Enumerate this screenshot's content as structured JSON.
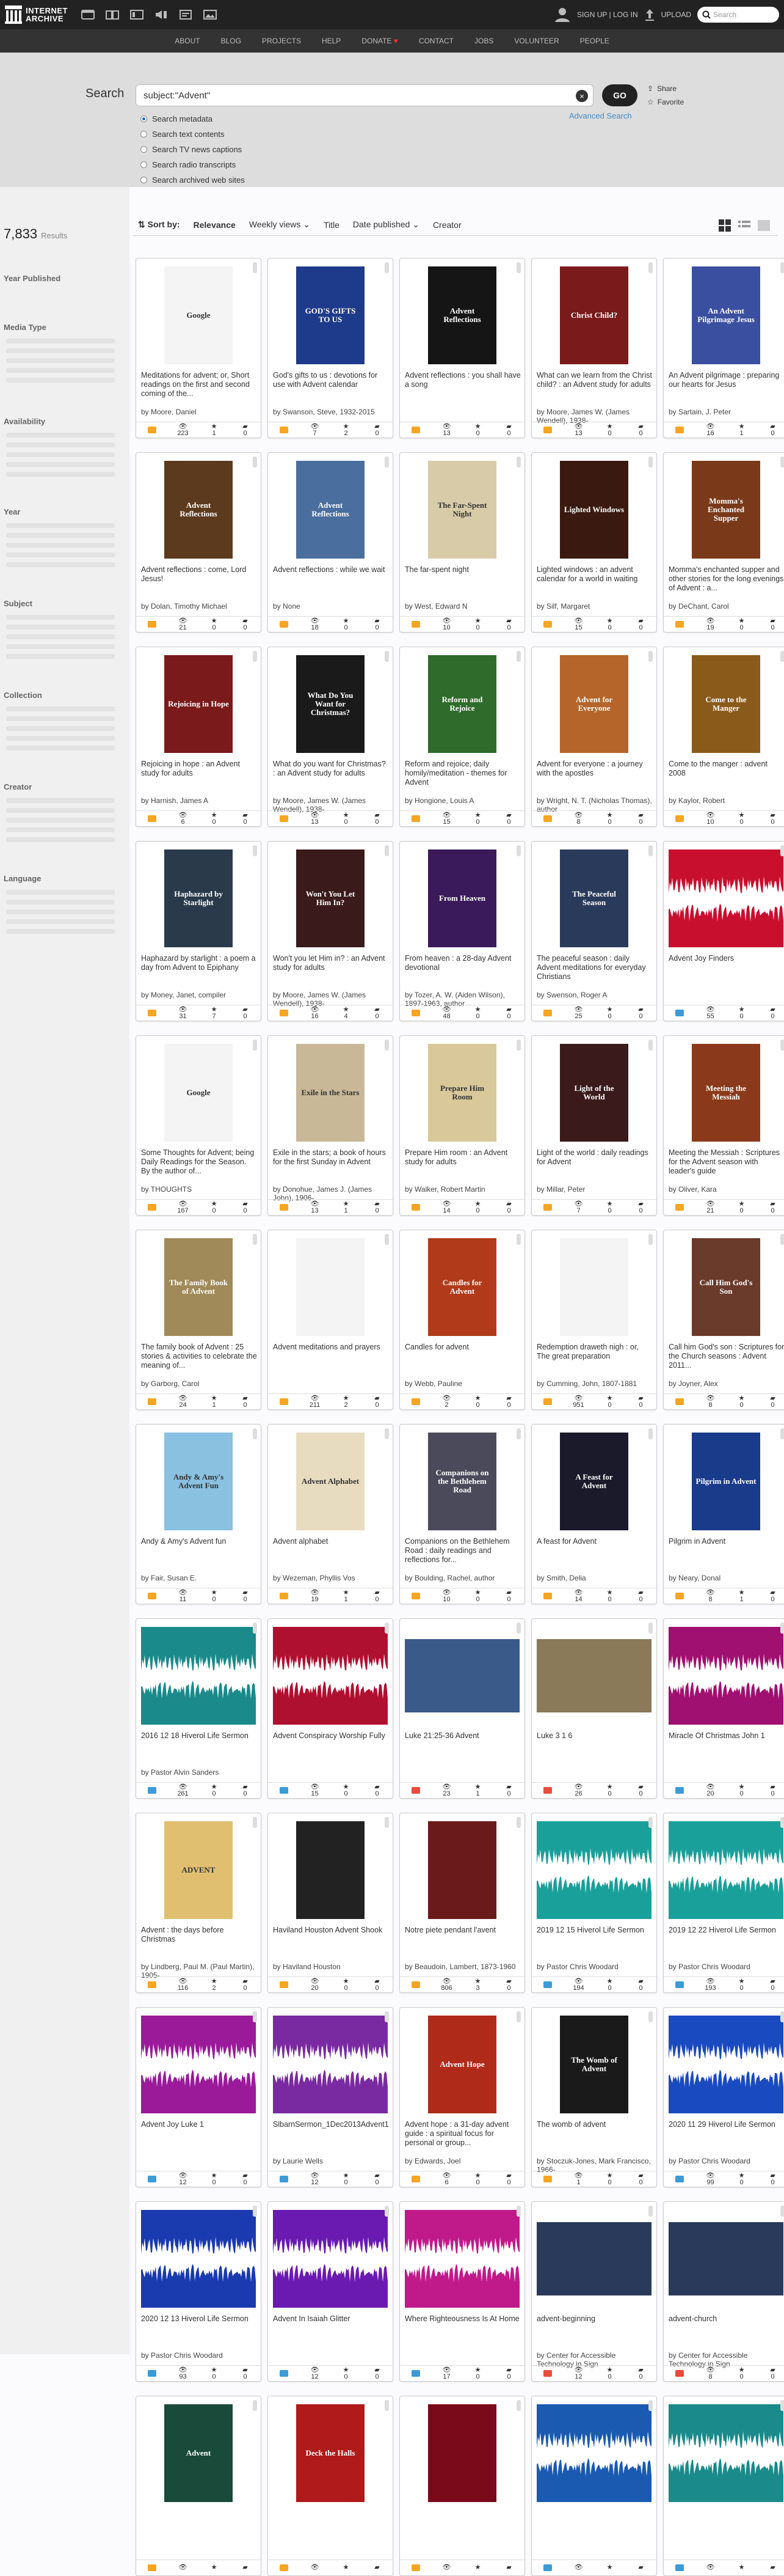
{
  "header": {
    "logo_line1": "INTERNET",
    "logo_line2": "ARCHIVE",
    "signup": "SIGN UP | LOG IN",
    "upload": "UPLOAD",
    "search_placeholder": "Search"
  },
  "subnav": [
    "ABOUT",
    "BLOG",
    "PROJECTS",
    "HELP",
    "DONATE",
    "CONTACT",
    "JOBS",
    "VOLUNTEER",
    "PEOPLE"
  ],
  "search": {
    "label": "Search",
    "query": "subject:\"Advent\"",
    "go": "GO",
    "share": "Share",
    "favorite": "Favorite",
    "advanced": "Advanced Search",
    "options": [
      "Search metadata",
      "Search text contents",
      "Search TV news captions",
      "Search radio transcripts",
      "Search archived web sites"
    ]
  },
  "sidebar": {
    "count": "7,833",
    "count_label": "Results",
    "facets": [
      "Year Published",
      "Media Type",
      "Availability",
      "Year",
      "Subject",
      "Collection",
      "Creator",
      "Language"
    ]
  },
  "sort": {
    "label": "Sort by:",
    "options": [
      "Relevance",
      "Weekly views",
      "Title",
      "Date published",
      "Creator"
    ]
  },
  "colors": {
    "text_type": "#f5a623",
    "audio_type": "#3d9bd6",
    "video_type": "#e84c3d"
  },
  "items": [
    {
      "title": "Meditations for advent; or, Short readings on the first and second coming of the...",
      "author": "by Moore, Daniel",
      "type": "text",
      "views": "223",
      "favs": "1",
      "reviews": "0",
      "thumb": "#f4f4f4",
      "label": "Google"
    },
    {
      "title": "God's gifts to us : devotions for use with Advent calendar",
      "author": "by Swanson, Steve, 1932-2015",
      "type": "text",
      "views": "7",
      "favs": "2",
      "reviews": "0",
      "thumb": "#1e3a8a",
      "label": "GOD'S GIFTS TO US"
    },
    {
      "title": "Advent reflections : you shall have a song",
      "author": "",
      "type": "text",
      "views": "13",
      "favs": "0",
      "reviews": "0",
      "thumb": "#151515",
      "label": "Advent Reflections"
    },
    {
      "title": "What can we learn from the Christ child? : an Advent study for adults",
      "author": "by Moore, James W. (James Wendell), 1938-",
      "type": "text",
      "views": "13",
      "favs": "0",
      "reviews": "0",
      "thumb": "#7a1a1a",
      "label": "Christ Child?"
    },
    {
      "title": "An Advent pilgrimage : preparing our hearts for Jesus",
      "author": "by Sartain, J. Peter",
      "type": "text",
      "views": "16",
      "favs": "1",
      "reviews": "0",
      "thumb": "#3a4fa0",
      "label": "An Advent Pilgrimage Jesus"
    },
    {
      "title": "Advent reflections : come, Lord Jesus!",
      "author": "by Dolan, Timothy Michael",
      "type": "text",
      "views": "21",
      "favs": "0",
      "reviews": "0",
      "thumb": "#5c3a1e",
      "label": "Advent Reflections"
    },
    {
      "title": "Advent reflections : while we wait",
      "author": "by None",
      "type": "text",
      "views": "18",
      "favs": "0",
      "reviews": "0",
      "thumb": "#4a6e9e",
      "label": "Advent Reflections"
    },
    {
      "title": "The far-spent night",
      "author": "by West, Edward N",
      "type": "text",
      "views": "10",
      "favs": "0",
      "reviews": "0",
      "thumb": "#d8cba8",
      "label": "The Far-Spent Night"
    },
    {
      "title": "Lighted windows : an advent calendar for a world in waiting",
      "author": "by Silf, Margaret",
      "type": "text",
      "views": "15",
      "favs": "0",
      "reviews": "0",
      "thumb": "#3a1a10",
      "label": "Lighted Windows"
    },
    {
      "title": "Momma's enchanted supper and other stories for the long evenings of Advent : a...",
      "author": "by DeChant, Carol",
      "type": "text",
      "views": "19",
      "favs": "0",
      "reviews": "0",
      "thumb": "#7a3a1a",
      "label": "Momma's Enchanted Supper"
    },
    {
      "title": "Rejoicing in hope : an Advent study for adults",
      "author": "by Harnish, James A",
      "type": "text",
      "views": "6",
      "favs": "0",
      "reviews": "0",
      "thumb": "#7a1a1a",
      "label": "Rejoicing in Hope"
    },
    {
      "title": "What do you want for Christmas? : an Advent study for adults",
      "author": "by Moore, James W. (James Wendell), 1938-",
      "type": "text",
      "views": "13",
      "favs": "0",
      "reviews": "0",
      "thumb": "#1a1a1a",
      "label": "What Do You Want for Christmas?"
    },
    {
      "title": "Reform and rejoice; daily homily/meditation - themes for Advent",
      "author": "by Hongione, Louis A",
      "type": "text",
      "views": "15",
      "favs": "0",
      "reviews": "0",
      "thumb": "#2f6b2a",
      "label": "Reform and Rejoice"
    },
    {
      "title": "Advent for everyone : a journey with the apostles",
      "author": "by Wright, N. T. (Nicholas Thomas), author",
      "type": "text",
      "views": "8",
      "favs": "0",
      "reviews": "0",
      "thumb": "#b5652a",
      "label": "Advent for Everyone"
    },
    {
      "title": "Come to the manger : advent 2008",
      "author": "by Kaylor, Robert",
      "type": "text",
      "views": "10",
      "favs": "0",
      "reviews": "0",
      "thumb": "#8a5a1a",
      "label": "Come to the Manger"
    },
    {
      "title": "Haphazard by starlight : a poem a day from Advent to Epiphany",
      "author": "by Money, Janet, compiler",
      "type": "text",
      "views": "31",
      "favs": "7",
      "reviews": "0",
      "thumb": "#2a3a4a",
      "label": "Haphazard by Starlight"
    },
    {
      "title": "Won't you let Him in? : an Advent study for adults",
      "author": "by Moore, James W. (James Wendell), 1938-",
      "type": "text",
      "views": "16",
      "favs": "4",
      "reviews": "0",
      "thumb": "#3a1a1a",
      "label": "Won't You Let Him In?"
    },
    {
      "title": "From heaven : a 28-day Advent devotional",
      "author": "by Tozer, A. W. (Aiden Wilson), 1897-1963, author",
      "type": "text",
      "views": "48",
      "favs": "0",
      "reviews": "0",
      "thumb": "#3a1a5a",
      "label": "From Heaven"
    },
    {
      "title": "The peaceful season : daily Advent meditations for everyday Christians",
      "author": "by Swenson, Roger A",
      "type": "text",
      "views": "25",
      "favs": "0",
      "reviews": "0",
      "thumb": "#2a3a5a",
      "label": "The Peaceful Season"
    },
    {
      "title": "Advent Joy Finders",
      "author": "",
      "type": "audio",
      "views": "55",
      "favs": "0",
      "reviews": "0",
      "thumb": "#c8102e",
      "label": ""
    },
    {
      "title": "Some Thoughts for Advent; being Daily Readings for the Season. By the author of...",
      "author": "by THOUGHTS",
      "type": "text",
      "views": "167",
      "favs": "0",
      "reviews": "0",
      "thumb": "#f4f4f4",
      "label": "Google"
    },
    {
      "title": "Exile in the stars; a book of hours for the first Sunday in Advent",
      "author": "by Donohue, James J. (James John), 1906-",
      "type": "text",
      "views": "13",
      "favs": "1",
      "reviews": "0",
      "thumb": "#c8b898",
      "label": "Exile in the Stars"
    },
    {
      "title": "Prepare Him room : an Advent study for adults",
      "author": "by Walker, Robert Martin",
      "type": "text",
      "views": "14",
      "favs": "0",
      "reviews": "0",
      "thumb": "#d8c89a",
      "label": "Prepare Him Room"
    },
    {
      "title": "Light of the world : daily readings for Advent",
      "author": "by Millar, Peter",
      "type": "text",
      "views": "7",
      "favs": "0",
      "reviews": "0",
      "thumb": "#3a1a1a",
      "label": "Light of the World"
    },
    {
      "title": "Meeting the Messiah : Scriptures for the Advent season with leader's guide",
      "author": "by Oliver, Kara",
      "type": "text",
      "views": "21",
      "favs": "0",
      "reviews": "0",
      "thumb": "#8a3a1a",
      "label": "Meeting the Messiah"
    },
    {
      "title": "The family book of Advent : 25 stories & activities to celebrate the meaning of...",
      "author": "by Garborg, Carol",
      "type": "text",
      "views": "24",
      "favs": "1",
      "reviews": "0",
      "thumb": "#a08a5a",
      "label": "The Family Book of Advent"
    },
    {
      "title": "Advent meditations and prayers",
      "author": "",
      "type": "text",
      "views": "211",
      "favs": "2",
      "reviews": "0",
      "thumb": "#f4f4f4",
      "label": ""
    },
    {
      "title": "Candles for advent",
      "author": "by Webb, Pauline",
      "type": "text",
      "views": "2",
      "favs": "0",
      "reviews": "0",
      "thumb": "#b03a1a",
      "label": "Candles for Advent"
    },
    {
      "title": "Redemption draweth nigh : or, The great preparation",
      "author": "by Cumming, John, 1807-1881",
      "type": "text",
      "views": "951",
      "favs": "0",
      "reviews": "0",
      "thumb": "#f4f4f4",
      "label": ""
    },
    {
      "title": "Call him God's son : Scriptures for the Church seasons : Advent 2011...",
      "author": "by Joyner, Alex",
      "type": "text",
      "views": "8",
      "favs": "0",
      "reviews": "0",
      "thumb": "#6a3a2a",
      "label": "Call Him God's Son"
    },
    {
      "title": "Andy & Amy's Advent fun",
      "author": "by Fair, Susan E.",
      "type": "text",
      "views": "11",
      "favs": "0",
      "reviews": "0",
      "thumb": "#8ac0e0",
      "label": "Andy & Amy's Advent Fun"
    },
    {
      "title": "Advent alphabet",
      "author": "by Wezeman, Phyllis Vos",
      "type": "text",
      "views": "19",
      "favs": "1",
      "reviews": "0",
      "thumb": "#e8dcc0",
      "label": "Advent Alphabet"
    },
    {
      "title": "Companions on the Bethlehem Road : daily readings and reflections for...",
      "author": "by Boulding, Rachel, author",
      "type": "text",
      "views": "10",
      "favs": "0",
      "reviews": "0",
      "thumb": "#4a4a5a",
      "label": "Companions on the Bethlehem Road"
    },
    {
      "title": "A feast for Advent",
      "author": "by Smith, Delia",
      "type": "text",
      "views": "14",
      "favs": "0",
      "reviews": "0",
      "thumb": "#1a1a2a",
      "label": "A Feast for Advent"
    },
    {
      "title": "Pilgrim in Advent",
      "author": "by Neary, Donal",
      "type": "text",
      "views": "8",
      "favs": "1",
      "reviews": "0",
      "thumb": "#1a3a8a",
      "label": "Pilgrim in Advent"
    },
    {
      "title": "2016 12 18 Hiverol Life Sermon",
      "author": "by Pastor Alvin Sanders",
      "type": "audio",
      "views": "261",
      "favs": "0",
      "reviews": "0",
      "thumb": "#1a8a8a",
      "label": ""
    },
    {
      "title": "Advent Conspiracy Worship Fully",
      "author": "",
      "type": "audio",
      "views": "15",
      "favs": "0",
      "reviews": "0",
      "thumb": "#b01030",
      "label": ""
    },
    {
      "title": "Luke 21:25-36 Advent",
      "author": "",
      "type": "video",
      "views": "23",
      "favs": "1",
      "reviews": "0",
      "thumb": "#3a5a8a",
      "label": ""
    },
    {
      "title": "Luke 3 1 6",
      "author": "",
      "type": "video",
      "views": "26",
      "favs": "0",
      "reviews": "0",
      "thumb": "#8a7a5a",
      "label": ""
    },
    {
      "title": "Miracle Of Christmas John 1",
      "author": "",
      "type": "audio",
      "views": "20",
      "favs": "0",
      "reviews": "0",
      "thumb": "#a01070",
      "label": ""
    },
    {
      "title": "Advent : the days before Christmas",
      "author": "by Lindberg, Paul M. (Paul Martin), 1905-",
      "type": "text",
      "views": "116",
      "favs": "2",
      "reviews": "0",
      "thumb": "#e0c070",
      "label": "ADVENT"
    },
    {
      "title": "Haviland Houston Advent Shook",
      "author": "by Haviland Houston",
      "type": "text",
      "views": "20",
      "favs": "0",
      "reviews": "0",
      "thumb": "#222222",
      "label": ""
    },
    {
      "title": "Notre piete pendant l'avent",
      "author": "by Beaudoin, Lambert, 1873-1960",
      "type": "text",
      "views": "806",
      "favs": "3",
      "reviews": "0",
      "thumb": "#6a1a1a",
      "label": ""
    },
    {
      "title": "2019 12 15 Hiverol Life Sermon",
      "author": "by Pastor Chris Woodard",
      "type": "audio",
      "views": "194",
      "favs": "0",
      "reviews": "0",
      "thumb": "#1aa09a",
      "label": ""
    },
    {
      "title": "2019 12 22 Hiverol Life Sermon",
      "author": "by Pastor Chris Woodard",
      "type": "audio",
      "views": "193",
      "favs": "0",
      "reviews": "0",
      "thumb": "#1aa09a",
      "label": ""
    },
    {
      "title": "Advent Joy Luke 1",
      "author": "",
      "type": "audio",
      "views": "12",
      "favs": "0",
      "reviews": "0",
      "thumb": "#9a1a9a",
      "label": ""
    },
    {
      "title": "SlbarnSermon_1Dec2013Advent1CRevLaurieWells",
      "author": "by Laurie Wells",
      "type": "audio",
      "views": "12",
      "favs": "0",
      "reviews": "0",
      "thumb": "#7a2aa0",
      "label": ""
    },
    {
      "title": "Advent hope : a 31-day advent guide : a spiritual focus for personal or group...",
      "author": "by Edwards, Joel",
      "type": "text",
      "views": "6",
      "favs": "0",
      "reviews": "0",
      "thumb": "#b02a1a",
      "label": "Advent Hope"
    },
    {
      "title": "The womb of advent",
      "author": "by Stoczuk-Jones, Mark Francisco, 1966-",
      "type": "text",
      "views": "1",
      "favs": "0",
      "reviews": "0",
      "thumb": "#1a1a1a",
      "label": "The Womb of Advent"
    },
    {
      "title": "2020 11 29 Hiverol Life Sermon",
      "author": "by Pastor Chris Woodard",
      "type": "audio",
      "views": "99",
      "favs": "0",
      "reviews": "0",
      "thumb": "#1a4ac0",
      "label": ""
    },
    {
      "title": "2020 12 13 Hiverol Life Sermon",
      "author": "by Pastor Chris Woodard",
      "type": "audio",
      "views": "93",
      "favs": "0",
      "reviews": "0",
      "thumb": "#1a3ab0",
      "label": ""
    },
    {
      "title": "Advent In Isaiah Glitter",
      "author": "",
      "type": "audio",
      "views": "12",
      "favs": "0",
      "reviews": "0",
      "thumb": "#6a1ab0",
      "label": ""
    },
    {
      "title": "Where Righteousness Is At Home",
      "author": "",
      "type": "audio",
      "views": "17",
      "favs": "0",
      "reviews": "0",
      "thumb": "#c01a8a",
      "label": ""
    },
    {
      "title": "advent-beginning",
      "author": "by Center for Accessible Technology in Sign",
      "type": "video",
      "views": "12",
      "favs": "0",
      "reviews": "0",
      "thumb": "#2a3a5a",
      "label": ""
    },
    {
      "title": "advent-church",
      "author": "by Center for Accessible Technology in Sign",
      "type": "video",
      "views": "8",
      "favs": "0",
      "reviews": "0",
      "thumb": "#2a3a5a",
      "label": ""
    },
    {
      "title": "",
      "author": "",
      "type": "text",
      "views": "",
      "favs": "",
      "reviews": "",
      "thumb": "#1a4a3a",
      "label": "Advent"
    },
    {
      "title": "",
      "author": "",
      "type": "text",
      "views": "",
      "favs": "",
      "reviews": "",
      "thumb": "#b01a1a",
      "label": "Deck the Halls"
    },
    {
      "title": "",
      "author": "",
      "type": "text",
      "views": "",
      "favs": "",
      "reviews": "",
      "thumb": "#7a0a1a",
      "label": ""
    },
    {
      "title": "",
      "author": "",
      "type": "audio",
      "views": "",
      "favs": "",
      "reviews": "",
      "thumb": "#1a5ab0",
      "label": ""
    },
    {
      "title": "",
      "author": "",
      "type": "audio",
      "views": "",
      "favs": "",
      "reviews": "",
      "thumb": "#1a8a8a",
      "label": ""
    }
  ]
}
